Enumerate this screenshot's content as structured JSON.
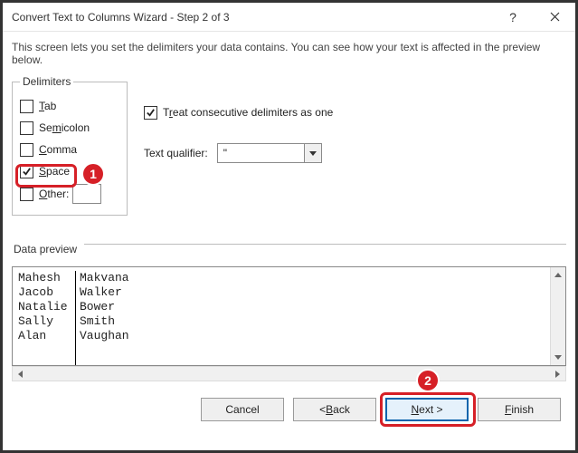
{
  "title": "Convert Text to Columns Wizard - Step 2 of 3",
  "description": "This screen lets you set the delimiters your data contains.  You can see how your text is affected in the preview below.",
  "delimiters": {
    "legend": "Delimiters",
    "tab": {
      "label_pre": "",
      "ul": "T",
      "label_post": "ab",
      "checked": false
    },
    "semi": {
      "label_pre": "Se",
      "ul": "m",
      "label_post": "icolon",
      "checked": false
    },
    "comma": {
      "label_pre": "",
      "ul": "C",
      "label_post": "omma",
      "checked": false
    },
    "space": {
      "label_pre": "",
      "ul": "S",
      "label_post": "pace",
      "checked": true
    },
    "other": {
      "label_pre": "",
      "ul": "O",
      "label_post": "ther:",
      "checked": false,
      "value": ""
    }
  },
  "treat": {
    "label_pre": "T",
    "ul": "r",
    "label_post": "eat consecutive delimiters as one",
    "checked": true
  },
  "qualifier": {
    "label_pre": "Text ",
    "ul": "q",
    "label_post": "ualifier:",
    "value": "\""
  },
  "preview": {
    "label_pre": "Data ",
    "ul": "p",
    "label_post": "review",
    "col1": "Mahesh\nJacob\nNatalie\nSally\nAlan",
    "col2": "Makvana\nWalker\nBower\nSmith\nVaughan"
  },
  "buttons": {
    "cancel": "Cancel",
    "back_pre": "< ",
    "back_ul": "B",
    "back_post": "ack",
    "next_pre": "",
    "next_ul": "N",
    "next_post": "ext >",
    "finish_pre": "",
    "finish_ul": "F",
    "finish_post": "inish"
  },
  "callouts": {
    "one": "1",
    "two": "2"
  }
}
